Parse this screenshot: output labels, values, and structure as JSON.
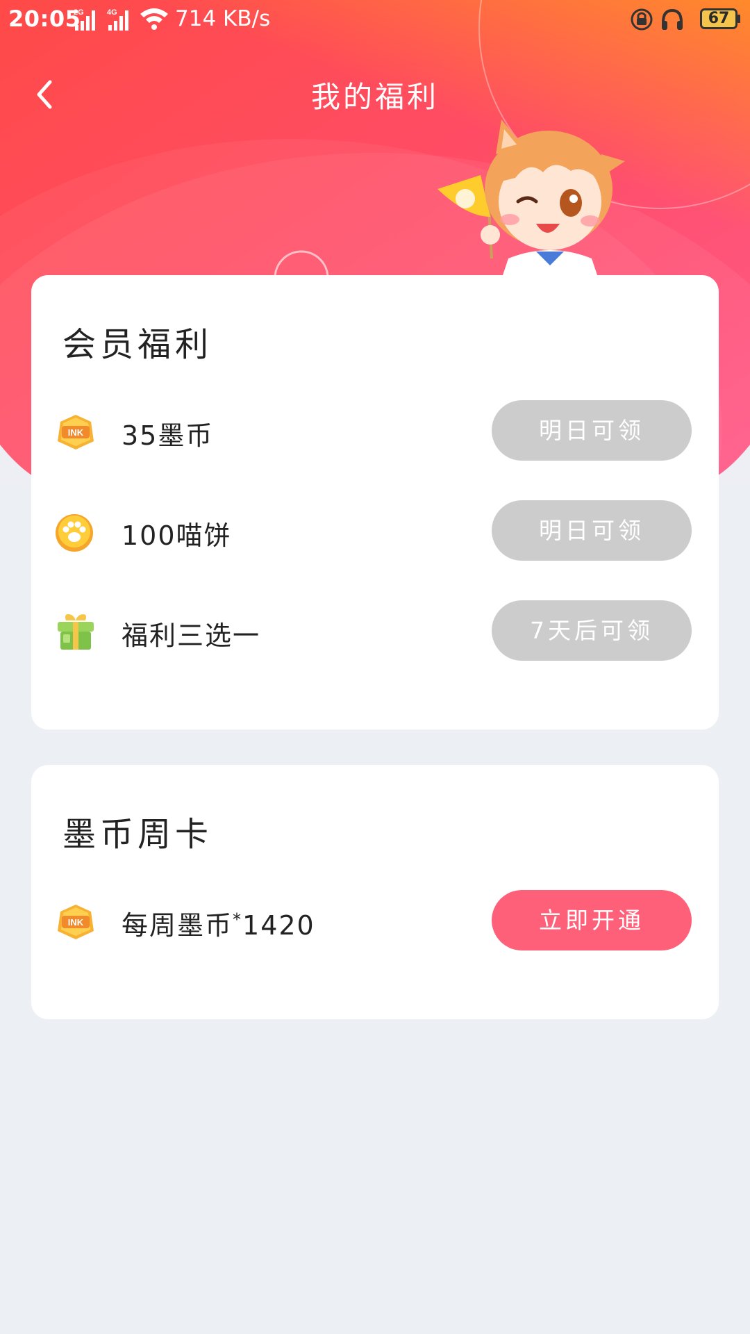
{
  "status_bar": {
    "time": "20:05",
    "network_speed": "714 KB/s",
    "battery": "67",
    "net_labels": [
      "2G",
      "4G"
    ]
  },
  "header": {
    "title": "我的福利",
    "back_icon": "chevron-left-icon"
  },
  "member_benefits": {
    "title": "会员福利",
    "items": [
      {
        "icon": "ink-coin-icon",
        "label": "35墨币",
        "button": "明日可领",
        "state": "disabled"
      },
      {
        "icon": "paw-coin-icon",
        "label": "100喵饼",
        "button": "明日可领",
        "state": "disabled"
      },
      {
        "icon": "gift-icon",
        "label": "福利三选一",
        "button": "7天后可领",
        "state": "disabled"
      }
    ]
  },
  "weekly_card": {
    "title": "墨币周卡",
    "items": [
      {
        "icon": "ink-coin-icon",
        "label_prefix": "每周墨币",
        "label_sup": "*",
        "label_suffix": "1420",
        "button": "立即开通",
        "state": "active"
      }
    ]
  },
  "colors": {
    "accent": "#ff6079",
    "disabled_button": "#cccccc",
    "background": "#eceff4",
    "hero_start": "#ff4b4b",
    "hero_end": "#ff5a86"
  }
}
